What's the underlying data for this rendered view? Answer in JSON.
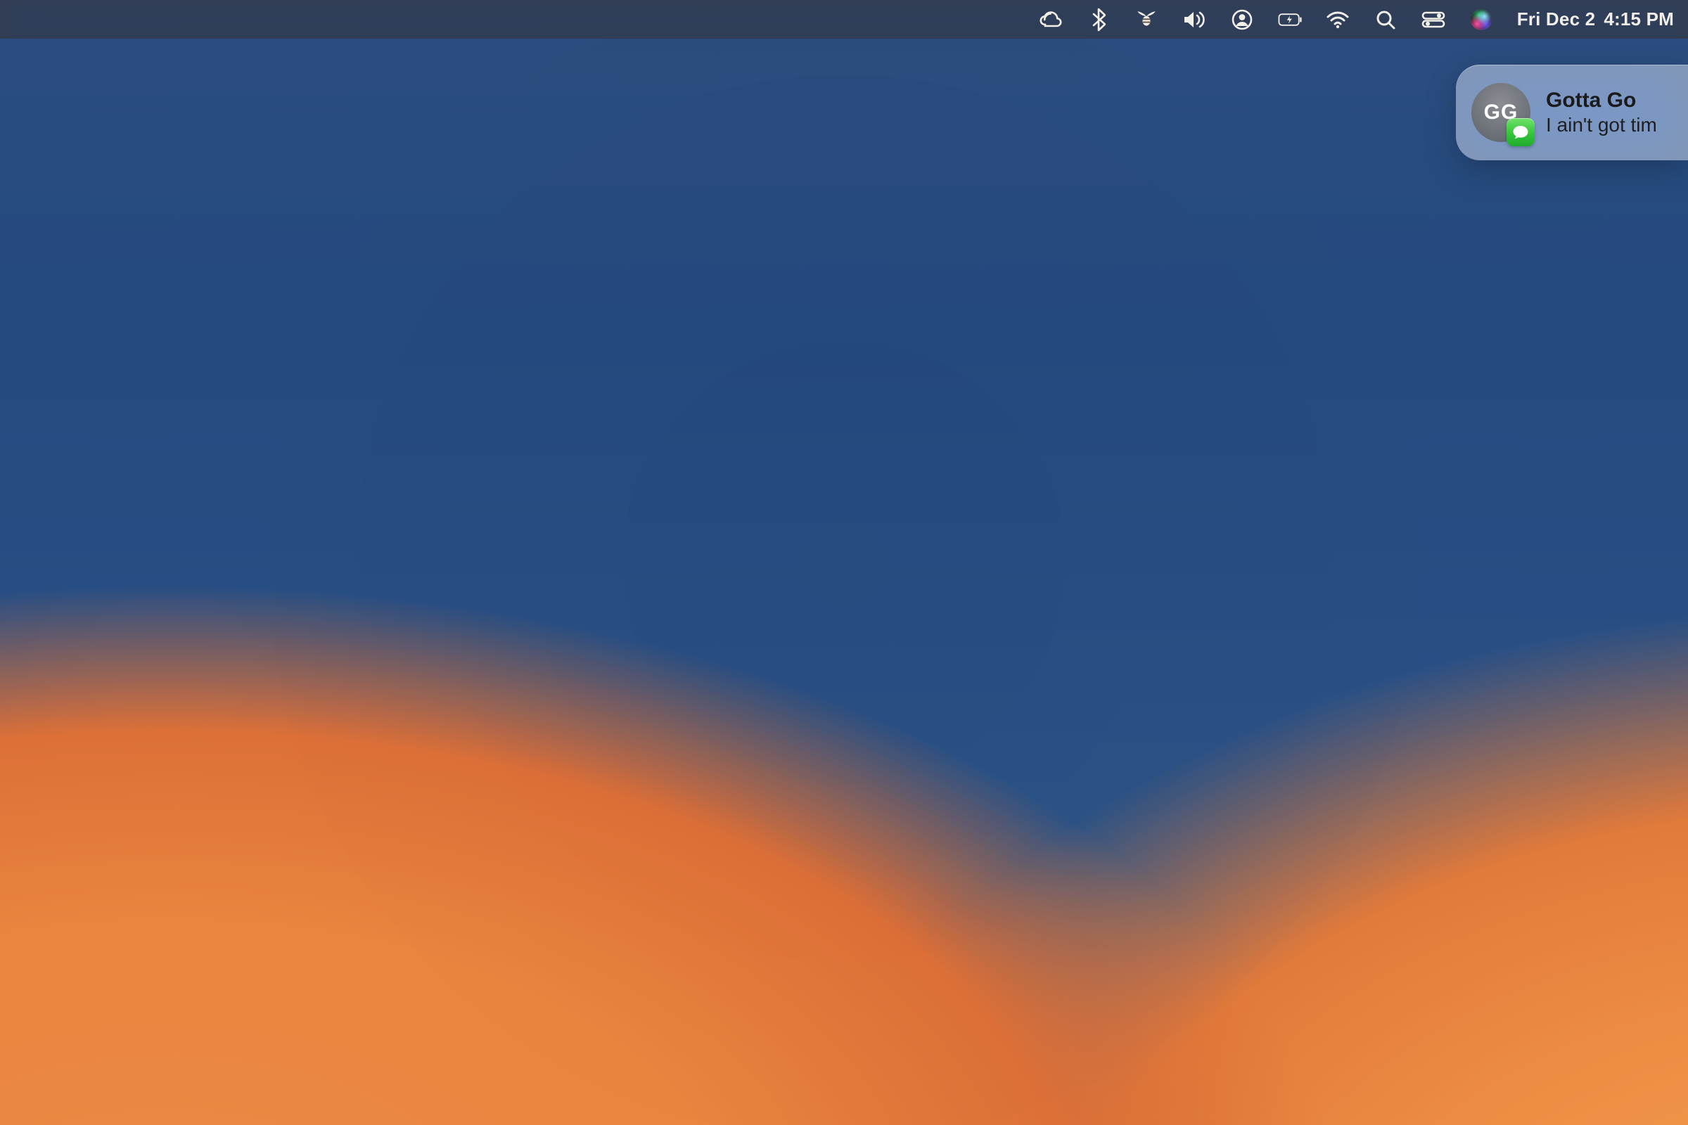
{
  "menubar": {
    "date": "Fri Dec 2",
    "time": "4:15 PM",
    "icon_color": "#f2efe9",
    "items": [
      {
        "name": "creative-cloud-icon"
      },
      {
        "name": "bluetooth-icon"
      },
      {
        "name": "bee-icon"
      },
      {
        "name": "volume-icon"
      },
      {
        "name": "user-switch-icon"
      },
      {
        "name": "battery-charging-icon"
      },
      {
        "name": "wifi-icon"
      },
      {
        "name": "spotlight-search-icon"
      },
      {
        "name": "control-center-icon"
      },
      {
        "name": "siri-icon"
      }
    ]
  },
  "notification": {
    "sender": "Gotta Go",
    "preview": "I ain't got tim",
    "avatar_initials": "GG",
    "app_badge": "messages-icon",
    "badge_color": "#35c43a"
  }
}
